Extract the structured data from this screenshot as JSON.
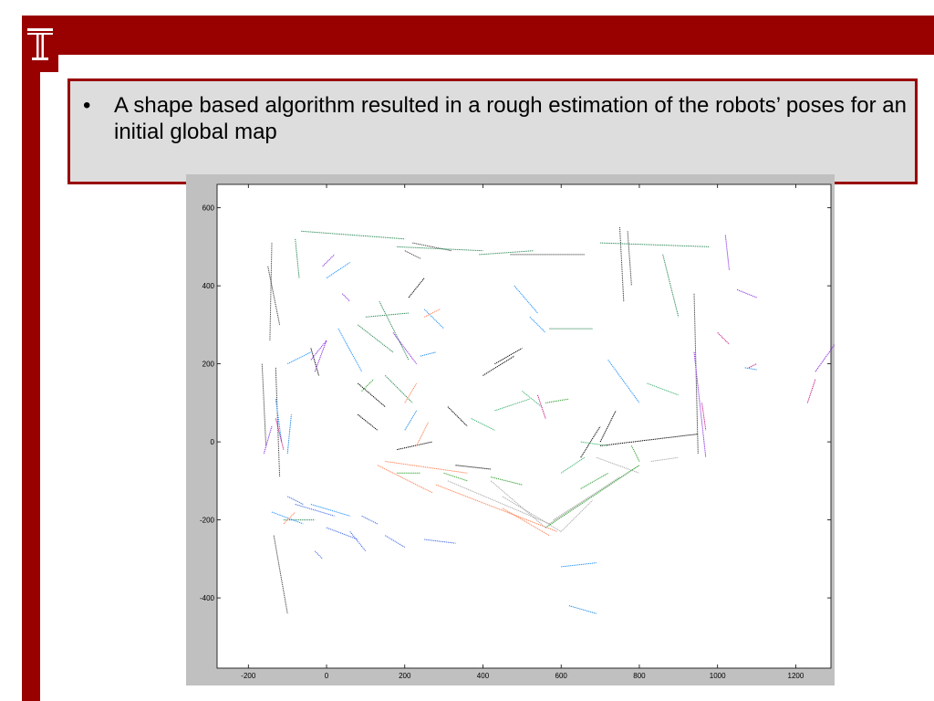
{
  "slide": {
    "bullet": "•",
    "text": "A shape based algorithm resulted in a rough estimation of the robots’ poses for an initial global map"
  },
  "logo": {
    "icon": "temple-t-logo",
    "color": "#990000"
  },
  "colors": {
    "brand": "#990000",
    "panel": "#dddddd",
    "figure_bg": "#c0c0c0"
  },
  "chart_data": {
    "type": "scatter",
    "title": "",
    "xlabel": "",
    "ylabel": "",
    "xlim": [
      -280,
      1290
    ],
    "ylim": [
      -580,
      660
    ],
    "xticks": [
      -200,
      0,
      200,
      400,
      600,
      800,
      1000,
      1200
    ],
    "yticks": [
      -400,
      -200,
      0,
      200,
      400,
      600
    ],
    "grid": false,
    "series": [
      {
        "color": "#444444",
        "segments": [
          [
            -140,
            510,
            -145,
            260
          ],
          [
            -165,
            200,
            -155,
            -10
          ],
          [
            -130,
            190,
            -120,
            -90
          ],
          [
            -150,
            450,
            -120,
            300
          ],
          [
            200,
            490,
            240,
            470
          ],
          [
            470,
            480,
            660,
            480
          ],
          [
            750,
            550,
            760,
            360
          ],
          [
            770,
            540,
            780,
            400
          ],
          [
            940,
            380,
            950,
            -30
          ],
          [
            -135,
            -240,
            -100,
            -440
          ],
          [
            220,
            510,
            320,
            490
          ]
        ]
      },
      {
        "color": "#2e8b57",
        "segments": [
          [
            -65,
            540,
            200,
            520
          ],
          [
            -80,
            520,
            -70,
            420
          ],
          [
            180,
            500,
            400,
            490
          ],
          [
            390,
            480,
            530,
            490
          ],
          [
            700,
            510,
            980,
            500
          ],
          [
            860,
            480,
            900,
            320
          ],
          [
            100,
            320,
            210,
            330
          ],
          [
            135,
            360,
            210,
            210
          ],
          [
            80,
            300,
            170,
            230
          ],
          [
            150,
            170,
            220,
            100
          ],
          [
            -110,
            -200,
            -30,
            -200
          ],
          [
            570,
            290,
            680,
            290
          ]
        ]
      },
      {
        "color": "#1e90ff",
        "segments": [
          [
            -100,
            200,
            -40,
            230
          ],
          [
            30,
            290,
            90,
            180
          ],
          [
            0,
            420,
            60,
            460
          ],
          [
            480,
            400,
            540,
            330
          ],
          [
            520,
            320,
            560,
            280
          ],
          [
            -140,
            -180,
            -60,
            -210
          ],
          [
            -40,
            -160,
            60,
            -190
          ],
          [
            720,
            210,
            800,
            100
          ],
          [
            600,
            -320,
            690,
            -310
          ],
          [
            -130,
            110,
            -115,
            0
          ],
          [
            250,
            340,
            300,
            290
          ]
        ]
      },
      {
        "color": "#000000",
        "segments": [
          [
            430,
            200,
            500,
            240
          ],
          [
            400,
            170,
            480,
            220
          ],
          [
            310,
            90,
            360,
            40
          ],
          [
            80,
            70,
            130,
            30
          ],
          [
            80,
            150,
            150,
            90
          ],
          [
            180,
            -20,
            270,
            0
          ],
          [
            700,
            0,
            740,
            80
          ],
          [
            650,
            -40,
            700,
            40
          ],
          [
            330,
            -60,
            420,
            -70
          ],
          [
            700,
            -10,
            950,
            20
          ],
          [
            -40,
            240,
            -20,
            170
          ],
          [
            210,
            370,
            250,
            420
          ]
        ]
      },
      {
        "color": "#8a2be2",
        "segments": [
          [
            -30,
            180,
            0,
            260
          ],
          [
            -10,
            450,
            20,
            480
          ],
          [
            -40,
            210,
            0,
            260
          ],
          [
            940,
            230,
            970,
            -40
          ],
          [
            1020,
            530,
            1030,
            440
          ],
          [
            1050,
            390,
            1100,
            370
          ],
          [
            170,
            280,
            230,
            200
          ],
          [
            40,
            380,
            60,
            360
          ],
          [
            -160,
            -30,
            -140,
            40
          ],
          [
            1250,
            180,
            1300,
            250
          ]
        ]
      },
      {
        "color": "#ff7f50",
        "segments": [
          [
            130,
            -60,
            270,
            -130
          ],
          [
            280,
            -110,
            590,
            -230
          ],
          [
            450,
            -170,
            570,
            -240
          ],
          [
            150,
            -50,
            360,
            -80
          ],
          [
            250,
            320,
            290,
            340
          ],
          [
            -110,
            -210,
            -80,
            -180
          ],
          [
            200,
            100,
            230,
            150
          ],
          [
            230,
            -10,
            260,
            50
          ]
        ]
      },
      {
        "color": "#aaaaaa",
        "segments": [
          [
            310,
            -100,
            570,
            -210
          ],
          [
            420,
            -100,
            560,
            -220
          ],
          [
            570,
            -210,
            750,
            -90
          ],
          [
            580,
            -200,
            800,
            -60
          ],
          [
            450,
            -140,
            600,
            -230
          ],
          [
            690,
            -40,
            800,
            -80
          ],
          [
            830,
            -50,
            900,
            -40
          ],
          [
            600,
            -230,
            680,
            -150
          ]
        ]
      },
      {
        "color": "#2ca02c",
        "segments": [
          [
            560,
            -220,
            800,
            -60
          ],
          [
            650,
            -120,
            720,
            -80
          ],
          [
            300,
            -80,
            360,
            -100
          ],
          [
            420,
            -90,
            500,
            -110
          ],
          [
            90,
            130,
            120,
            160
          ],
          [
            780,
            -10,
            800,
            -50
          ],
          [
            560,
            100,
            620,
            110
          ],
          [
            180,
            -80,
            240,
            -80
          ]
        ]
      },
      {
        "color": "#4169e1",
        "segments": [
          [
            -80,
            -160,
            20,
            -190
          ],
          [
            0,
            -220,
            80,
            -250
          ],
          [
            60,
            -230,
            100,
            -280
          ],
          [
            150,
            -240,
            200,
            -270
          ],
          [
            250,
            -250,
            330,
            -260
          ],
          [
            -100,
            -140,
            -60,
            -160
          ],
          [
            90,
            -190,
            130,
            -210
          ],
          [
            -30,
            -280,
            -10,
            -300
          ]
        ]
      },
      {
        "color": "#c71585",
        "segments": [
          [
            1000,
            280,
            1030,
            250
          ],
          [
            1080,
            190,
            1100,
            200
          ],
          [
            1230,
            100,
            1250,
            160
          ],
          [
            -130,
            60,
            -110,
            -20
          ],
          [
            960,
            100,
            970,
            30
          ],
          [
            540,
            120,
            560,
            60
          ]
        ]
      },
      {
        "color": "#3cb371",
        "segments": [
          [
            500,
            130,
            550,
            90
          ],
          [
            430,
            80,
            520,
            110
          ],
          [
            370,
            60,
            430,
            30
          ],
          [
            600,
            -80,
            660,
            -40
          ],
          [
            650,
            0,
            720,
            -10
          ],
          [
            820,
            150,
            900,
            120
          ]
        ]
      },
      {
        "color": "#1e88e5",
        "segments": [
          [
            -100,
            -30,
            -90,
            70
          ],
          [
            620,
            -420,
            690,
            -440
          ],
          [
            1070,
            190,
            1100,
            185
          ],
          [
            200,
            30,
            230,
            80
          ],
          [
            240,
            220,
            280,
            230
          ]
        ]
      }
    ]
  }
}
